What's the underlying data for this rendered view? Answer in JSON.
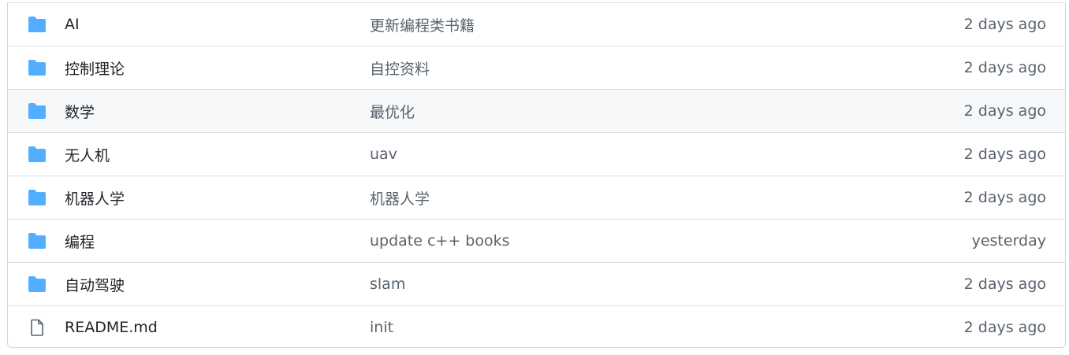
{
  "rows": [
    {
      "name": "AI",
      "message": "更新编程类书籍",
      "age": "2 days ago",
      "icon": "folder-icon",
      "hover": false
    },
    {
      "name": "控制理论",
      "message": "自控资料",
      "age": "2 days ago",
      "icon": "folder-icon",
      "hover": false
    },
    {
      "name": "数学",
      "message": "最优化",
      "age": "2 days ago",
      "icon": "folder-icon",
      "hover": true
    },
    {
      "name": "无人机",
      "message": "uav",
      "age": "2 days ago",
      "icon": "folder-icon",
      "hover": false
    },
    {
      "name": "机器人学",
      "message": "机器人学",
      "age": "2 days ago",
      "icon": "folder-icon",
      "hover": false
    },
    {
      "name": "编程",
      "message": "update c++ books",
      "age": "yesterday",
      "icon": "folder-icon",
      "hover": false
    },
    {
      "name": "自动驾驶",
      "message": "slam",
      "age": "2 days ago",
      "icon": "folder-icon",
      "hover": false
    },
    {
      "name": "README.md",
      "message": "init",
      "age": "2 days ago",
      "icon": "file-icon",
      "hover": false
    }
  ],
  "colors": {
    "folder": "#54aeff",
    "file_stroke": "#59636e",
    "name_text": "#1f2328",
    "muted_text": "#59636e",
    "border": "#d0d7de",
    "hover_bg": "#f6f8fa"
  }
}
